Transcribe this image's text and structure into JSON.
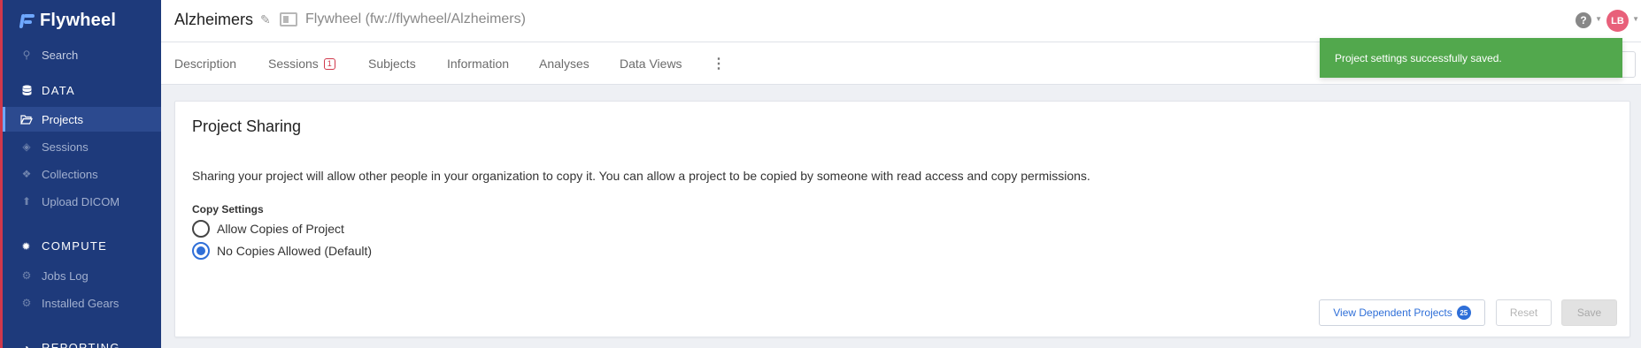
{
  "app": {
    "logo_text": "Flywheel"
  },
  "sidebar": {
    "search": "Search",
    "data_section": "DATA",
    "data_items": [
      "Projects",
      "Sessions",
      "Collections",
      "Upload DICOM"
    ],
    "compute_section": "COMPUTE",
    "compute_items": [
      "Jobs Log",
      "Installed Gears"
    ],
    "reporting_section": "REPORTING",
    "accent_color": "#1e3a7b"
  },
  "header": {
    "title": "Alzheimers",
    "path": "Flywheel (fw://flywheel/Alzheimers)",
    "help_symbol": "?",
    "avatar_initials": "LB"
  },
  "tabs": {
    "items": [
      "Description",
      "Sessions",
      "Subjects",
      "Information",
      "Analyses",
      "Data Views"
    ],
    "sessions_badge": "1",
    "more_symbol": "⋮"
  },
  "toast": {
    "message": "Project settings successfully saved.",
    "color": "#52a84d"
  },
  "card": {
    "title": "Project Sharing",
    "description": "Sharing your project will allow other people in your organization to copy it. You can allow a project to be copied by someone with read access and copy permissions.",
    "copy_settings_label": "Copy Settings",
    "options": [
      {
        "label": "Allow Copies of Project",
        "checked": false
      },
      {
        "label": "No Copies Allowed (Default)",
        "checked": true
      }
    ],
    "buttons": {
      "view_dependent": "View Dependent Projects",
      "dependent_count": "25",
      "reset": "Reset",
      "save": "Save"
    }
  }
}
